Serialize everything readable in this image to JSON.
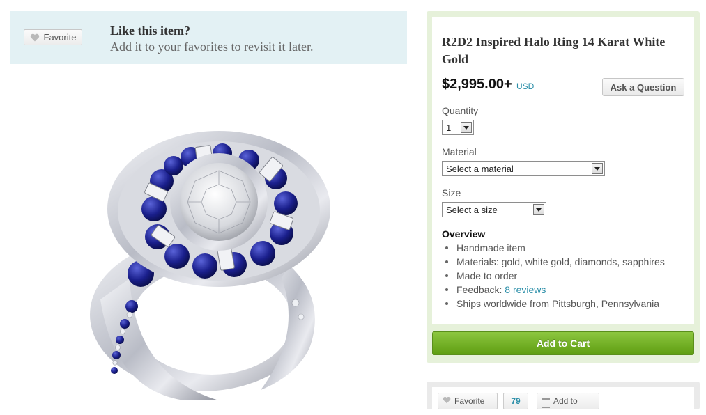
{
  "favorite_banner": {
    "button_label": "Favorite",
    "title": "Like this item?",
    "subtitle": "Add it to your favorites to revisit it later."
  },
  "product": {
    "title": "R2D2 Inspired Halo Ring 14 Karat White Gold",
    "price": "$2,995.00+",
    "currency": "USD",
    "ask_button": "Ask a Question",
    "quantity": {
      "label": "Quantity",
      "value": "1"
    },
    "material": {
      "label": "Material",
      "value": "Select a material"
    },
    "size": {
      "label": "Size",
      "value": "Select a size"
    },
    "overview": {
      "heading": "Overview",
      "handmade": "Handmade item",
      "materials": "Materials: gold, white gold, diamonds, sapphires",
      "made_to_order": "Made to order",
      "feedback_prefix": "Feedback: ",
      "feedback_link": "8 reviews",
      "ships": "Ships worldwide from Pittsburgh, Pennsylvania"
    },
    "add_to_cart": "Add to Cart"
  },
  "bottom_bar": {
    "favorite_label": "Favorite",
    "favorite_count": "79",
    "add_to_label": "Add to"
  },
  "colors": {
    "banner_bg": "#e3f1f4",
    "panel_border": "#e6f1da",
    "cart_green": "#7ab52a",
    "link_blue": "#2a8ea8",
    "sapphire": "#1a1f8c"
  },
  "icons": [
    "heart-icon",
    "dropdown-arrow-icon",
    "list-icon"
  ]
}
